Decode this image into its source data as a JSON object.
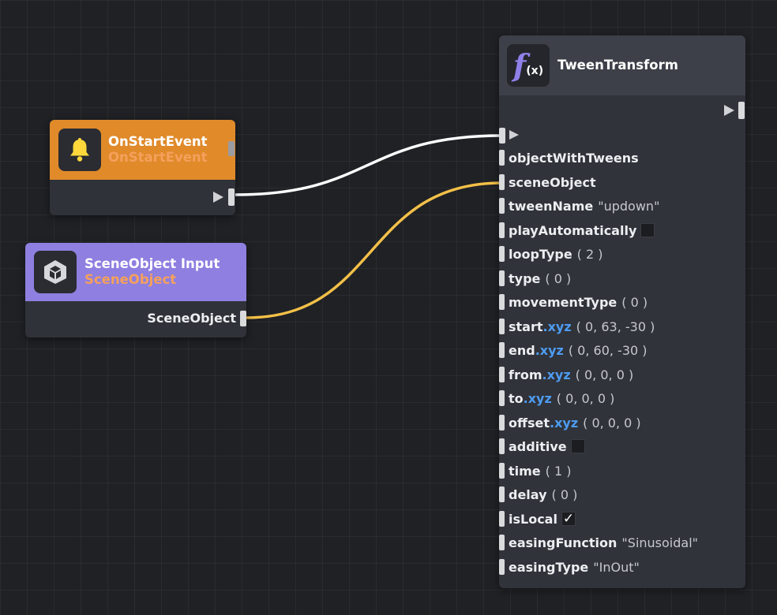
{
  "wire_colors": {
    "exec": "#ffffff",
    "object": "#f3c048"
  },
  "on_start_node": {
    "title": "OnStartEvent",
    "subtitle": "OnStartEvent",
    "icon": "bell-icon",
    "header_color": "#e08a2a"
  },
  "scene_object_node": {
    "title": "SceneObject Input",
    "subtitle": "SceneObject",
    "icon": "cube-icon",
    "header_color": "#8e7fe0",
    "output_label": "SceneObject"
  },
  "tween_node": {
    "title": "TweenTransform",
    "icon": "function-icon",
    "icon_letter": "f",
    "icon_suffix": "(x)",
    "inputs": {
      "objectWithTweens": {
        "label": "objectWithTweens"
      },
      "sceneObject": {
        "label": "sceneObject"
      },
      "tweenName": {
        "label": "tweenName",
        "value": "\"updown\""
      },
      "playAutomatically": {
        "label": "playAutomatically",
        "checked": false
      },
      "loopType": {
        "label": "loopType",
        "value": "( 2 )"
      },
      "type": {
        "label": "type",
        "value": "( 0 )"
      },
      "movementType": {
        "label": "movementType",
        "value": "( 0 )"
      },
      "start": {
        "label": "start",
        "accessor": ".xyz",
        "value": "( 0, 63, -30 )"
      },
      "end": {
        "label": "end",
        "accessor": ".xyz",
        "value": "( 0, 60, -30 )"
      },
      "from": {
        "label": "from",
        "accessor": ".xyz",
        "value": "( 0, 0, 0 )"
      },
      "to": {
        "label": "to",
        "accessor": ".xyz",
        "value": "( 0, 0, 0 )"
      },
      "offset": {
        "label": "offset",
        "accessor": ".xyz",
        "value": "( 0, 0, 0 )"
      },
      "additive": {
        "label": "additive",
        "checked": false
      },
      "time": {
        "label": "time",
        "value": "( 1 )"
      },
      "delay": {
        "label": "delay",
        "value": "( 0 )"
      },
      "isLocal": {
        "label": "isLocal",
        "checked": true,
        "check_glyph": "✓"
      },
      "easingFunction": {
        "label": "easingFunction",
        "value": "\"Sinusoidal\""
      },
      "easingType": {
        "label": "easingType",
        "value": "\"InOut\""
      }
    }
  }
}
